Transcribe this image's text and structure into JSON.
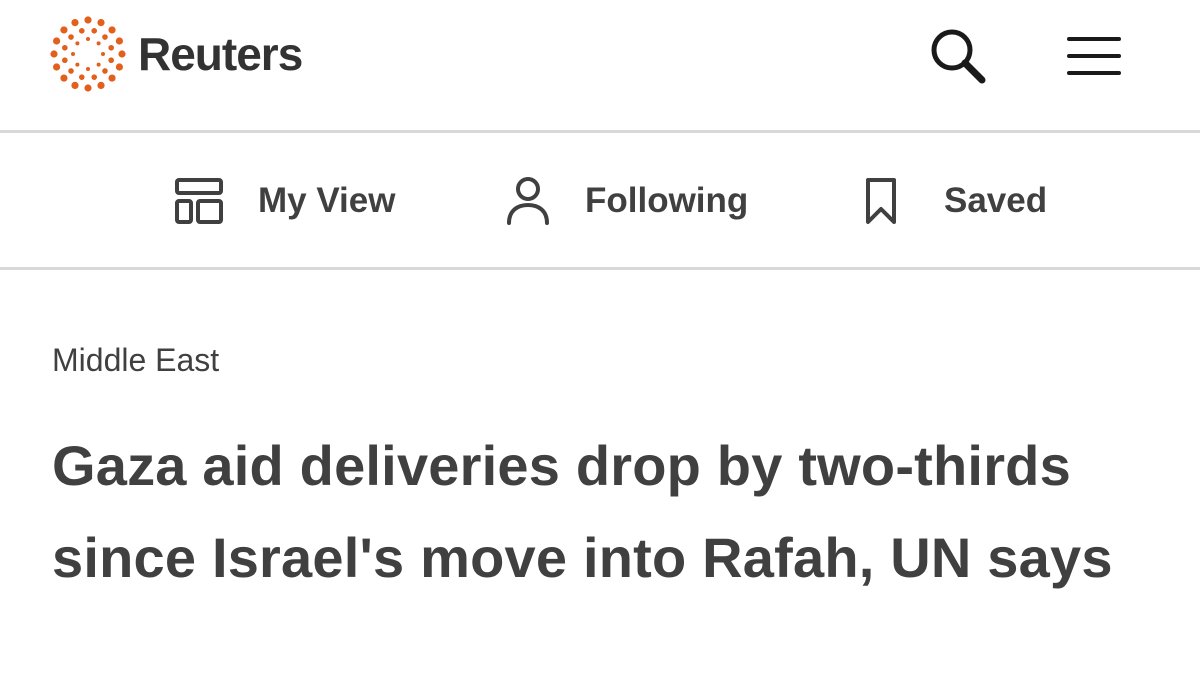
{
  "header": {
    "brand": "Reuters",
    "brand_color": "#e35f1c",
    "search_icon": "search-icon",
    "menu_icon": "hamburger-menu-icon"
  },
  "subnav": {
    "items": [
      {
        "label": "My View",
        "icon": "layout-grid-icon"
      },
      {
        "label": "Following",
        "icon": "person-icon"
      },
      {
        "label": "Saved",
        "icon": "bookmark-icon"
      }
    ]
  },
  "article": {
    "section": "Middle East",
    "headline": "Gaza aid deliveries drop by two-thirds since Israel's move into Rafah, UN says"
  }
}
